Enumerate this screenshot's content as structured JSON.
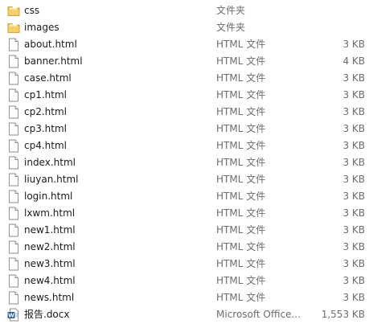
{
  "files": [
    {
      "name": "css",
      "type": "文件夹",
      "size": "",
      "icon": "folder-icon"
    },
    {
      "name": "images",
      "type": "文件夹",
      "size": "",
      "icon": "folder-icon"
    },
    {
      "name": "about.html",
      "type": "HTML 文件",
      "size": "3 KB",
      "icon": "html-file-icon"
    },
    {
      "name": "banner.html",
      "type": "HTML 文件",
      "size": "4 KB",
      "icon": "html-file-icon"
    },
    {
      "name": "case.html",
      "type": "HTML 文件",
      "size": "3 KB",
      "icon": "html-file-icon"
    },
    {
      "name": "cp1.html",
      "type": "HTML 文件",
      "size": "3 KB",
      "icon": "html-file-icon"
    },
    {
      "name": "cp2.html",
      "type": "HTML 文件",
      "size": "3 KB",
      "icon": "html-file-icon"
    },
    {
      "name": "cp3.html",
      "type": "HTML 文件",
      "size": "3 KB",
      "icon": "html-file-icon"
    },
    {
      "name": "cp4.html",
      "type": "HTML 文件",
      "size": "3 KB",
      "icon": "html-file-icon"
    },
    {
      "name": "index.html",
      "type": "HTML 文件",
      "size": "3 KB",
      "icon": "html-file-icon"
    },
    {
      "name": "liuyan.html",
      "type": "HTML 文件",
      "size": "3 KB",
      "icon": "html-file-icon"
    },
    {
      "name": "login.html",
      "type": "HTML 文件",
      "size": "3 KB",
      "icon": "html-file-icon"
    },
    {
      "name": "lxwm.html",
      "type": "HTML 文件",
      "size": "3 KB",
      "icon": "html-file-icon"
    },
    {
      "name": "new1.html",
      "type": "HTML 文件",
      "size": "3 KB",
      "icon": "html-file-icon"
    },
    {
      "name": "new2.html",
      "type": "HTML 文件",
      "size": "3 KB",
      "icon": "html-file-icon"
    },
    {
      "name": "new3.html",
      "type": "HTML 文件",
      "size": "3 KB",
      "icon": "html-file-icon"
    },
    {
      "name": "new4.html",
      "type": "HTML 文件",
      "size": "3 KB",
      "icon": "html-file-icon"
    },
    {
      "name": "news.html",
      "type": "HTML 文件",
      "size": "3 KB",
      "icon": "html-file-icon"
    },
    {
      "name": "报告.docx",
      "type": "Microsoft Office...",
      "size": "1,553 KB",
      "icon": "word-document-icon"
    }
  ],
  "colors": {
    "name_text": "#1b1b1b",
    "detail_text": "#6d6d6d",
    "folder": "#e8b84a",
    "word_blue": "#2b5797"
  }
}
